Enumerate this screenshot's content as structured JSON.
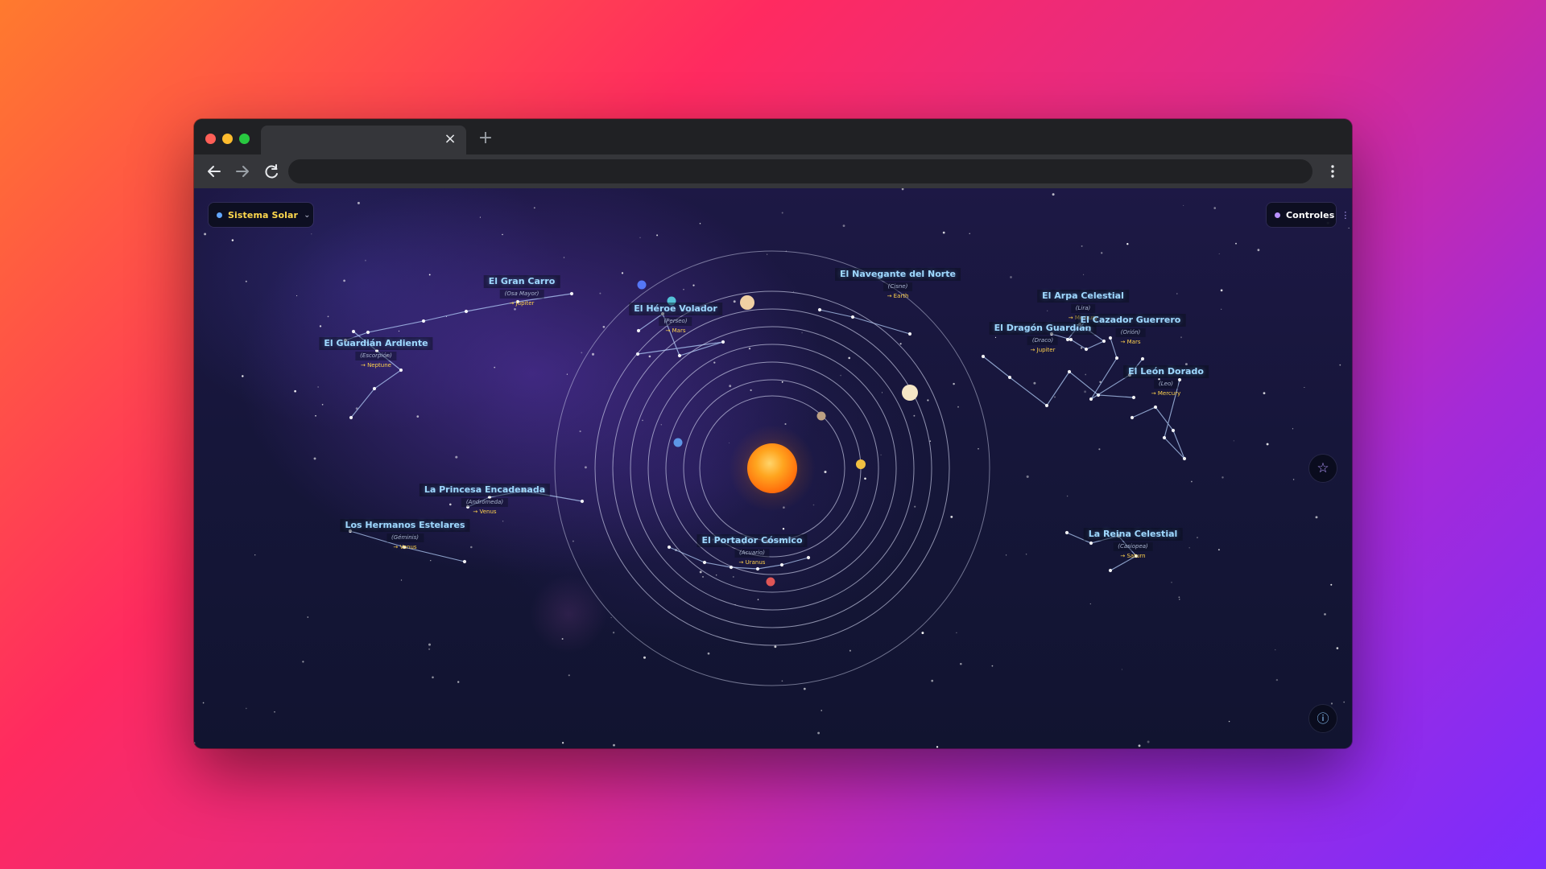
{
  "browser": {
    "tab_title": "",
    "tab_close_icon": "×",
    "new_tab_icon": "+",
    "address_text": ""
  },
  "app": {
    "system_selector": {
      "label": "Sistema Solar",
      "icon": "chevron-down-icon",
      "label_color": "#ffd84d",
      "dot_color": "#62a7ff"
    },
    "controls": {
      "label": "Controles",
      "label_color": "#ffffff",
      "dot_color": "#b991ff",
      "grip_icon": "drag-dots-icon"
    },
    "favorite_button_icon": "star-icon",
    "info_button_icon": "info-icon"
  },
  "constellations": [
    {
      "id": "gran-carro",
      "name": "El Gran Carro",
      "latin": "(Osa Mayor)",
      "planet": "→ Jupiter"
    },
    {
      "id": "heroe-volador",
      "name": "El Héroe Volador",
      "latin": "(Perseo)",
      "planet": "→ Mars"
    },
    {
      "id": "navegante-norte",
      "name": "El Navegante del Norte",
      "latin": "(Cisne)",
      "planet": "→ Earth"
    },
    {
      "id": "arpa-celestial",
      "name": "El Arpa Celestial",
      "latin": "(Lira)",
      "planet": "→ Mercury"
    },
    {
      "id": "dragon-guardian",
      "name": "El Dragón Guardián",
      "latin": "(Draco)",
      "planet": "→ Jupiter"
    },
    {
      "id": "cazador-guerrero",
      "name": "El Cazador Guerrero",
      "latin": "(Orión)",
      "planet": "→ Mars"
    },
    {
      "id": "guardian-ardiente",
      "name": "El Guardián Ardiente",
      "latin": "(Escorpión)",
      "planet": "→ Neptune"
    },
    {
      "id": "leon-dorado",
      "name": "El León Dorado",
      "latin": "(Leo)",
      "planet": "→ Mercury"
    },
    {
      "id": "princesa-encadenada",
      "name": "La Princesa Encadenada",
      "latin": "(Andrómeda)",
      "planet": "→ Venus"
    },
    {
      "id": "hermanos-estelares",
      "name": "Los Hermanos Estelares",
      "latin": "(Géminis)",
      "planet": "→ Venus"
    },
    {
      "id": "portador-cosmico",
      "name": "El Portador Cósmico",
      "latin": "(Acuario)",
      "planet": "→ Uranus"
    },
    {
      "id": "reina-celestial",
      "name": "La Reina Celestial",
      "latin": "(Casiopea)",
      "planet": "→ Saturn"
    }
  ],
  "colors": {
    "sun": "#ff9f1a",
    "orbit": "#d8dcf5",
    "constellation_line": "#b8d4ff",
    "planet_mercury": "#bda083",
    "planet_venus": "#f1c041",
    "planet_earth": "#5d96e6",
    "planet_mars": "#df5656",
    "planet_jupiter": "#f0d0a3",
    "planet_saturn": "#f5e6c6",
    "planet_uranus": "#54c2d7",
    "planet_neptune": "#5577f5"
  }
}
